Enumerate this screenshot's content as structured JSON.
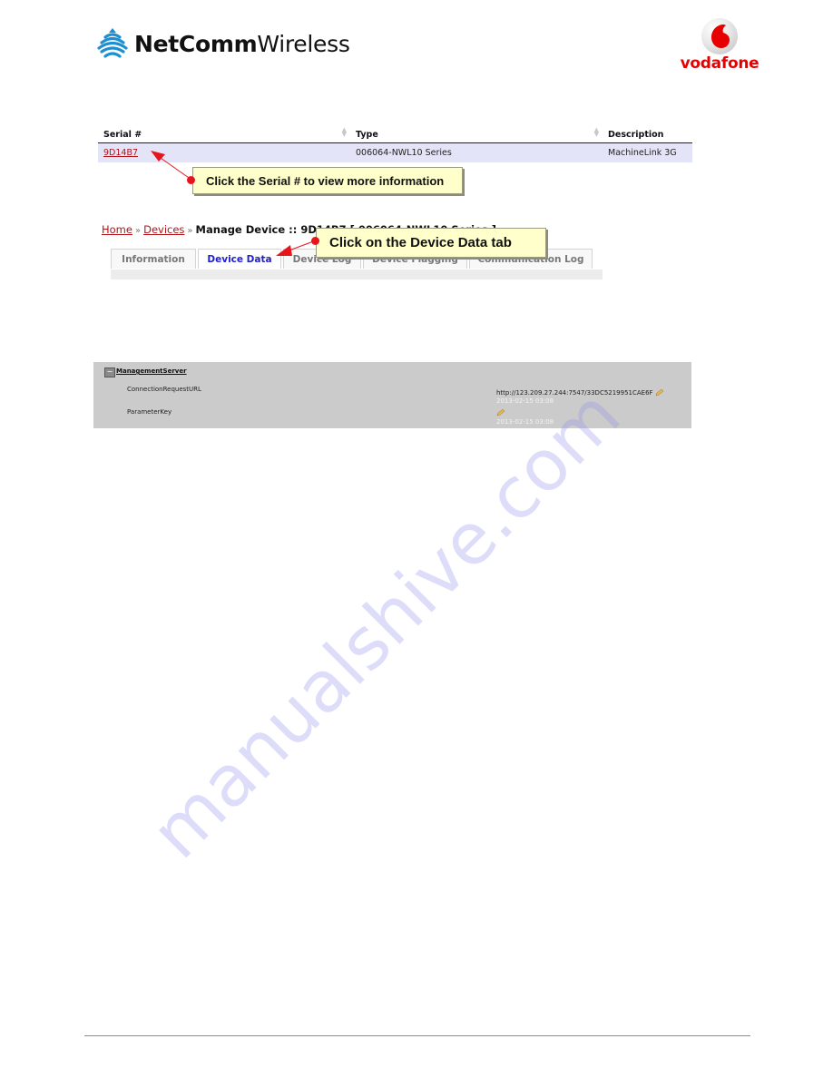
{
  "header": {
    "netcomm_logo": {
      "bold": "NetComm",
      "light": "Wireless",
      "icon": "wifi-signal-icon",
      "icon_color": "#1e8fd0"
    },
    "vodafone_logo": {
      "text": "vodafone",
      "icon": "vodafone-speechmark-icon",
      "brand_color": "#e60000"
    }
  },
  "device_table": {
    "columns": [
      "Serial #",
      "Type",
      "Description"
    ],
    "rows": [
      {
        "serial": "9D14B7",
        "type": "006064-NWL10 Series",
        "description": "MachineLink 3G"
      }
    ],
    "sort_icon": "sort-arrows-icon"
  },
  "callouts": {
    "serial": "Click the Serial # to view more information",
    "tab": "Click on the Device Data tab"
  },
  "breadcrumb": {
    "items": [
      "Home",
      "Devices"
    ],
    "separator": "»",
    "current": "Manage Device :: 9D14B7 [ 006064-NWL10 Series ]"
  },
  "tabs": [
    {
      "label": "Information",
      "active": false
    },
    {
      "label": "Device Data",
      "active": true
    },
    {
      "label": "Device Log",
      "active": false
    },
    {
      "label": "Device Flagging",
      "active": false
    },
    {
      "label": "Communication Log",
      "active": false
    }
  ],
  "device_data": {
    "group_label": "ManagementServer",
    "collapse_symbol": "−",
    "params": [
      {
        "name": "ConnectionRequestURL",
        "value": "http://123.209.27.244:7547/33DC5219951CAE6F",
        "timestamp": "2013-02-15 03:08"
      },
      {
        "name": "ParameterKey",
        "value": "",
        "timestamp": "2013-02-15 03:08"
      }
    ]
  },
  "watermark": "manualshive.com"
}
